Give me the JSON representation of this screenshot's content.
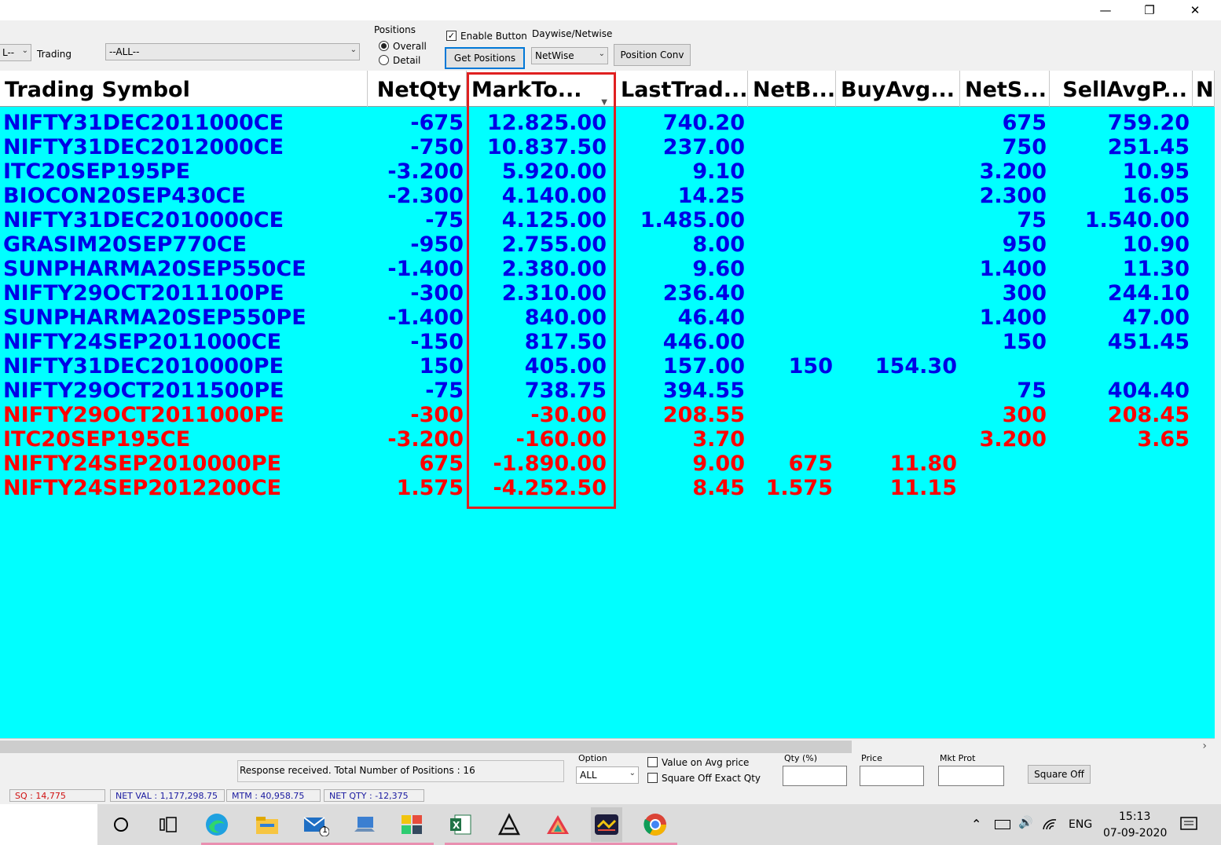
{
  "window": {
    "minimize_glyph": "—",
    "maximize_glyph": "❐",
    "close_glyph": "✕"
  },
  "toolbar": {
    "left_combo_value": "L--",
    "trading_label": "Trading",
    "trading_combo_value": "--ALL--",
    "positions_label": "Positions",
    "radio_overall_label": "Overall",
    "radio_detail_label": "Detail",
    "selected_position_mode": "Overall",
    "enable_button_label": "Enable Button",
    "enable_button_checked": true,
    "get_positions_label": "Get Positions",
    "daywise_netwise_label": "Daywise/Netwise",
    "netwise_combo_value": "NetWise",
    "position_conv_label": "Position Conv"
  },
  "grid": {
    "columns": [
      "Trading Symbol",
      "NetQty",
      "MarkTo...",
      "LastTrad...",
      "NetB...",
      "BuyAvg...",
      "NetS...",
      "SellAvgP...",
      "N"
    ],
    "colors": {
      "profit": "#0000e6",
      "loss": "#ff0000",
      "background": "#00ffff",
      "highlight": "#e02020"
    },
    "rows": [
      {
        "symbol": "NIFTY31DEC2011000CE",
        "netqty": "-675",
        "mtm": "12.825.00",
        "ltp": "740.20",
        "netbuy": "",
        "buyavg": "",
        "netsell": "675",
        "sellavg": "759.20",
        "status": "profit"
      },
      {
        "symbol": "NIFTY31DEC2012000CE",
        "netqty": "-750",
        "mtm": "10.837.50",
        "ltp": "237.00",
        "netbuy": "",
        "buyavg": "",
        "netsell": "750",
        "sellavg": "251.45",
        "status": "profit"
      },
      {
        "symbol": "ITC20SEP195PE",
        "netqty": "-3.200",
        "mtm": "5.920.00",
        "ltp": "9.10",
        "netbuy": "",
        "buyavg": "",
        "netsell": "3.200",
        "sellavg": "10.95",
        "status": "profit"
      },
      {
        "symbol": "BIOCON20SEP430CE",
        "netqty": "-2.300",
        "mtm": "4.140.00",
        "ltp": "14.25",
        "netbuy": "",
        "buyavg": "",
        "netsell": "2.300",
        "sellavg": "16.05",
        "status": "profit"
      },
      {
        "symbol": "NIFTY31DEC2010000CE",
        "netqty": "-75",
        "mtm": "4.125.00",
        "ltp": "1.485.00",
        "netbuy": "",
        "buyavg": "",
        "netsell": "75",
        "sellavg": "1.540.00",
        "status": "profit"
      },
      {
        "symbol": "GRASIM20SEP770CE",
        "netqty": "-950",
        "mtm": "2.755.00",
        "ltp": "8.00",
        "netbuy": "",
        "buyavg": "",
        "netsell": "950",
        "sellavg": "10.90",
        "status": "profit"
      },
      {
        "symbol": "SUNPHARMA20SEP550CE",
        "netqty": "-1.400",
        "mtm": "2.380.00",
        "ltp": "9.60",
        "netbuy": "",
        "buyavg": "",
        "netsell": "1.400",
        "sellavg": "11.30",
        "status": "profit"
      },
      {
        "symbol": "NIFTY29OCT2011100PE",
        "netqty": "-300",
        "mtm": "2.310.00",
        "ltp": "236.40",
        "netbuy": "",
        "buyavg": "",
        "netsell": "300",
        "sellavg": "244.10",
        "status": "profit"
      },
      {
        "symbol": "SUNPHARMA20SEP550PE",
        "netqty": "-1.400",
        "mtm": "840.00",
        "ltp": "46.40",
        "netbuy": "",
        "buyavg": "",
        "netsell": "1.400",
        "sellavg": "47.00",
        "status": "profit"
      },
      {
        "symbol": "NIFTY24SEP2011000CE",
        "netqty": "-150",
        "mtm": "817.50",
        "ltp": "446.00",
        "netbuy": "",
        "buyavg": "",
        "netsell": "150",
        "sellavg": "451.45",
        "status": "profit"
      },
      {
        "symbol": "NIFTY31DEC2010000PE",
        "netqty": "150",
        "mtm": "405.00",
        "ltp": "157.00",
        "netbuy": "150",
        "buyavg": "154.30",
        "netsell": "",
        "sellavg": "",
        "status": "profit"
      },
      {
        "symbol": "NIFTY29OCT2011500PE",
        "netqty": "-75",
        "mtm": "738.75",
        "ltp": "394.55",
        "netbuy": "",
        "buyavg": "",
        "netsell": "75",
        "sellavg": "404.40",
        "status": "profit"
      },
      {
        "symbol": "NIFTY29OCT2011000PE",
        "netqty": "-300",
        "mtm": "-30.00",
        "ltp": "208.55",
        "netbuy": "",
        "buyavg": "",
        "netsell": "300",
        "sellavg": "208.45",
        "status": "loss"
      },
      {
        "symbol": "ITC20SEP195CE",
        "netqty": "-3.200",
        "mtm": "-160.00",
        "ltp": "3.70",
        "netbuy": "",
        "buyavg": "",
        "netsell": "3.200",
        "sellavg": "3.65",
        "status": "loss"
      },
      {
        "symbol": "NIFTY24SEP2010000PE",
        "netqty": "675",
        "mtm": "-1.890.00",
        "ltp": "9.00",
        "netbuy": "675",
        "buyavg": "11.80",
        "netsell": "",
        "sellavg": "",
        "status": "loss"
      },
      {
        "symbol": "NIFTY24SEP2012200CE",
        "netqty": "1.575",
        "mtm": "-4.252.50",
        "ltp": "8.45",
        "netbuy": "1.575",
        "buyavg": "11.15",
        "netsell": "",
        "sellavg": "",
        "status": "loss"
      }
    ]
  },
  "bottom": {
    "response_text": "Response received.  Total Number of Positions : 16",
    "option_label": "Option",
    "option_value": "ALL",
    "value_on_avg_label": "Value on Avg  price",
    "square_off_exact_label": "Square Off Exact Qty",
    "qty_label": "Qty (%)",
    "price_label": "Price",
    "mkt_prot_label": "Mkt Prot",
    "square_off_button": "Square Off",
    "status_sq": "SQ : 14,775",
    "status_net_val": "NET VAL : 1,177,298.75",
    "status_mtm": "MTM : 40,958.75",
    "status_net_qty": "NET QTY : -12,375"
  },
  "taskbar": {
    "mail_badge": "1",
    "language": "ENG",
    "time": "15:13",
    "date": "07-09-2020",
    "icons": [
      "cortana-icon",
      "task-view-icon",
      "edge-icon",
      "file-explorer-icon",
      "mail-icon",
      "laptop-icon",
      "app-tiles-icon",
      "excel-icon",
      "trading-app-a-icon",
      "trading-app-triangle-icon",
      "trading-app-active-icon",
      "chrome-icon"
    ]
  }
}
